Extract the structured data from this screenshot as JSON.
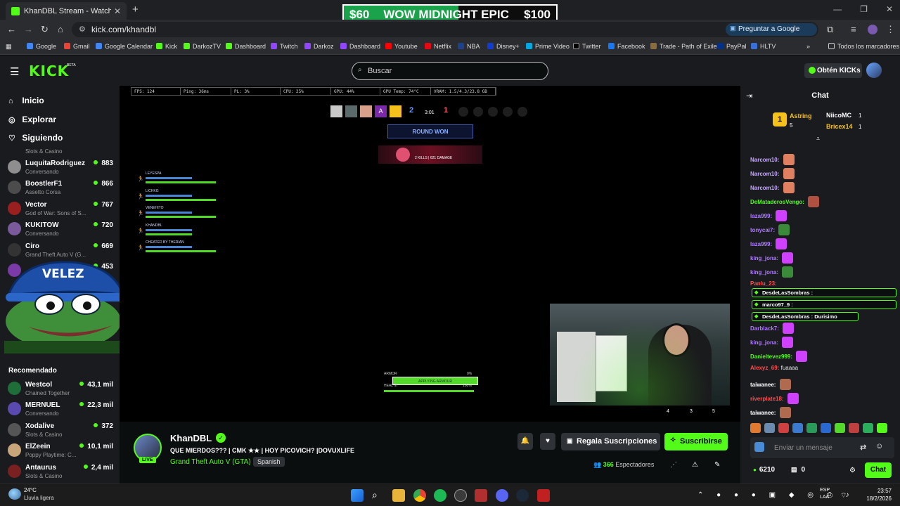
{
  "browser": {
    "tab_title": "KhanDBL Stream - Watch Live o",
    "url": "kick.com/khandbl",
    "ask_google": "Preguntar a Google",
    "bookmarks": [
      "Google",
      "Gmail",
      "Google Calendar",
      "Kick",
      "DarkozTV",
      "Dashboard",
      "Twitch",
      "Darkoz",
      "Dashboard",
      "Youtube",
      "Netflix",
      "NBA",
      "Disney+",
      "Prime Video",
      "Twitter",
      "Facebook",
      "Trade - Path of Exile",
      "PayPal",
      "HLTV"
    ],
    "all_bookmarks": "Todos los marcadores"
  },
  "banner": {
    "left": "$60",
    "middle": "WOW MIDNIGHT EPIC",
    "right": "$100"
  },
  "header": {
    "logo": "KICK",
    "beta": "BETA",
    "search_placeholder": "Buscar",
    "get_kicks": "Obtén KICKs"
  },
  "sidebar": {
    "nav": [
      "Inicio",
      "Explorar",
      "Siguiendo"
    ],
    "partial_category": "Slots & Casino",
    "following": [
      {
        "name": "LuquitaRodriguez",
        "category": "Conversando",
        "viewers": "883",
        "color": "#8e8e8e"
      },
      {
        "name": "BoostlerF1",
        "category": "Assetto Corsa",
        "viewers": "866",
        "color": "#4c4c4c"
      },
      {
        "name": "Vector",
        "category": "God of War: Sons of S...",
        "viewers": "767",
        "color": "#9a1f1f"
      },
      {
        "name": "KUKITOW",
        "category": "Conversando",
        "viewers": "720",
        "color": "#7a5a9a"
      },
      {
        "name": "Ciro",
        "category": "Grand Theft Auto V (G...",
        "viewers": "669",
        "color": "#333333"
      },
      {
        "name": "",
        "category": "",
        "viewers": "453",
        "color": "#7a3aa8"
      }
    ],
    "recommended_title": "Recomendado",
    "recommended": [
      {
        "name": "Westcol",
        "category": "Chained Together",
        "viewers": "43,1 mil",
        "color": "#1f6e3a"
      },
      {
        "name": "MERNUEL",
        "category": "Conversando",
        "viewers": "22,3 mil",
        "color": "#5a4ab0"
      },
      {
        "name": "Xodalive",
        "category": "Slots & Casino",
        "viewers": "372",
        "color": "#555555"
      },
      {
        "name": "ElZeein",
        "category": "Poppy Playtime: C...",
        "viewers": "10,1 mil",
        "color": "#c9a57a"
      },
      {
        "name": "Antaurus",
        "category": "Slots & Casino",
        "viewers": "2,4 mil",
        "color": "#7a2020"
      }
    ],
    "overlay_text": "VELEZ"
  },
  "game_hud": {
    "stats": [
      "FPS: 124",
      "Ping: 36ms",
      "PL: 3%",
      "CPU: 25%",
      "GPU: 44%",
      "GPU Temp: 74°C",
      "VRAM: 1.5/4.3/23.8 GB"
    ],
    "score_left": "2",
    "timer": "3:01",
    "score_right": "1",
    "round_banner": "ROUND WON",
    "kill_info": "2 KILLS | 621 DAMAGE",
    "team": [
      "LEYESPA",
      "LICHKG",
      "VENEHITO",
      "KHANDBL",
      "CHEATED BY THERIAN"
    ],
    "armor_label": "ARMOR",
    "armor_value": "0%",
    "health_label": "HEALTH",
    "health_value": "100%",
    "applying": "APPLYING ARMOUR",
    "bottom_counts": [
      "4",
      "3",
      "5"
    ]
  },
  "stream": {
    "streamer": "KhanDBL",
    "live": "LIVE",
    "title": "QUE MIERDOS??? | CMK ★★ | HOY PICOVICH? |DOVUXLIFE",
    "category": "Grand Theft Auto V (GTA)",
    "language": "Spanish",
    "gift_label": "Regala Suscripciones",
    "subscribe_label": "Suscribirse",
    "viewers": "366",
    "viewers_label": "Espectadores"
  },
  "chat": {
    "title": "Chat",
    "leaderboard": [
      {
        "rank": "1",
        "name": "Astring",
        "count": "5",
        "color": "#f4c21a"
      },
      {
        "name": "NiicoMC",
        "count": "1",
        "color": "#ffffff"
      },
      {
        "name": "Bricex14",
        "count": "1",
        "color": "#f4c21a"
      }
    ],
    "messages": [
      {
        "user": "Narcom10",
        "text": "",
        "color": "#c7a7ff"
      },
      {
        "user": "Narcom10",
        "text": "",
        "color": "#c7a7ff"
      },
      {
        "user": "Narcom10",
        "text": "",
        "color": "#c7a7ff"
      },
      {
        "user": "DeMataderosVengo",
        "text": "",
        "color": "#53fc18"
      },
      {
        "user": "laza999",
        "text": "",
        "color": "#b07aff"
      },
      {
        "user": "tonycai7",
        "text": "",
        "color": "#b07aff"
      },
      {
        "user": "laza999",
        "text": "",
        "color": "#b07aff"
      },
      {
        "user": "king_jona",
        "text": "",
        "color": "#b07aff"
      },
      {
        "user": "king_jona",
        "text": "",
        "color": "#b07aff"
      },
      {
        "user": "Panlu_23",
        "text": "",
        "color": "#ff4d4d"
      },
      {
        "user": "Darblack7",
        "text": "",
        "color": "#b07aff"
      },
      {
        "user": "king_jona",
        "text": "",
        "color": "#b07aff"
      },
      {
        "user": "Danieltevez999",
        "text": "",
        "color": "#53fc18"
      },
      {
        "user": "Alexyz_69",
        "text": "fuaaaa",
        "color": "#ff4d4d"
      },
      {
        "user": "taiwanee",
        "text": "",
        "color": "#ffffff"
      },
      {
        "user": "riverplate18",
        "text": "",
        "color": "#ff4d4d"
      },
      {
        "user": "taiwanee",
        "text": "",
        "color": "#ffffff"
      }
    ],
    "pinned": [
      {
        "user": "DesdeLasSombras",
        "text": ""
      },
      {
        "user": "marco97_9",
        "text": ""
      },
      {
        "user": "DesdeLasSombras",
        "text": "Durisimo"
      }
    ],
    "input_placeholder": "Enviar un mensaje",
    "kicks": "6210",
    "boxes": "0",
    "send_label": "Chat"
  },
  "taskbar": {
    "temp": "24°C",
    "condition": "Lluvia ligera",
    "lang1": "ESP",
    "lang2": "LAA",
    "time": "23:57",
    "date": "18/2/2026"
  },
  "colors": {
    "accent": "#53fc18",
    "bg": "#0b0e0f",
    "panel": "#191b1f"
  }
}
